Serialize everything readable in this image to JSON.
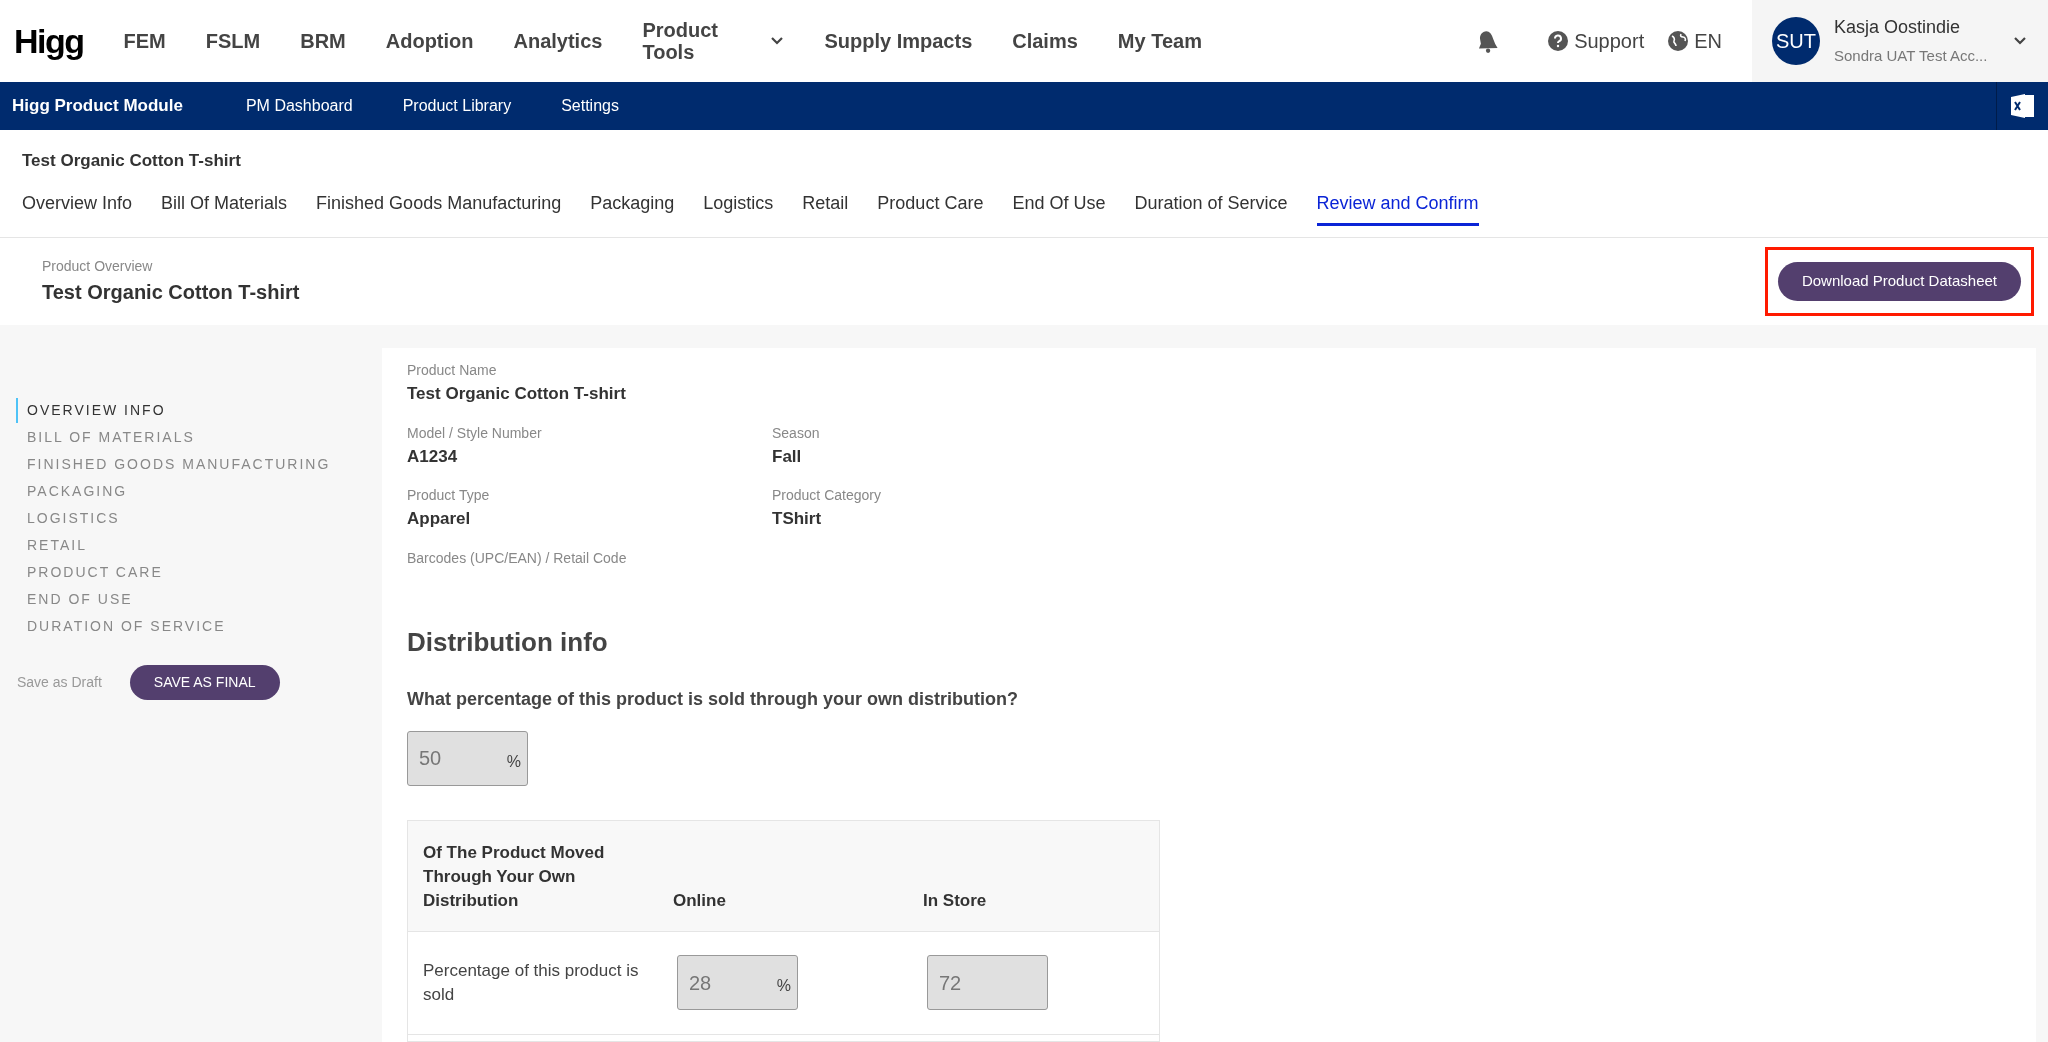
{
  "top_nav": {
    "logo": "Higg",
    "items": [
      {
        "label": "FEM",
        "dropdown": false
      },
      {
        "label": "FSLM",
        "dropdown": false
      },
      {
        "label": "BRM",
        "dropdown": false
      },
      {
        "label": "Adoption",
        "dropdown": false
      },
      {
        "label": "Analytics",
        "dropdown": false
      },
      {
        "label": "Product Tools",
        "dropdown": true
      },
      {
        "label": "Supply Impacts",
        "dropdown": false
      },
      {
        "label": "Claims",
        "dropdown": false
      },
      {
        "label": "My Team",
        "dropdown": false
      }
    ],
    "support": "Support",
    "language": "EN",
    "user": {
      "initials": "SUT",
      "name": "Kasja Oostindie",
      "organization": "Sondra UAT Test Acc..."
    }
  },
  "module_bar": {
    "title": "Higg Product Module",
    "items": [
      "PM Dashboard",
      "Product Library",
      "Settings"
    ]
  },
  "product_title": "Test Organic Cotton T-shirt",
  "tabs": [
    {
      "label": "Overview Info",
      "selected": false
    },
    {
      "label": "Bill Of Materials",
      "selected": false
    },
    {
      "label": "Finished Goods Manufacturing",
      "selected": false
    },
    {
      "label": "Packaging",
      "selected": false
    },
    {
      "label": "Logistics",
      "selected": false
    },
    {
      "label": "Retail",
      "selected": false
    },
    {
      "label": "Product Care",
      "selected": false
    },
    {
      "label": "End Of Use",
      "selected": false
    },
    {
      "label": "Duration of Service",
      "selected": false
    },
    {
      "label": "Review and Confirm",
      "selected": true
    }
  ],
  "overview": {
    "label": "Product Overview",
    "title": "Test Organic Cotton T-shirt",
    "download_button": "Download Product Datasheet",
    "highlighted": true
  },
  "sidebar": {
    "items": [
      {
        "label": "OVERVIEW INFO",
        "selected": true
      },
      {
        "label": "BILL OF MATERIALS",
        "selected": false
      },
      {
        "label": "FINISHED GOODS MANUFACTURING",
        "selected": false
      },
      {
        "label": "PACKAGING",
        "selected": false
      },
      {
        "label": "LOGISTICS",
        "selected": false
      },
      {
        "label": "RETAIL",
        "selected": false
      },
      {
        "label": "PRODUCT CARE",
        "selected": false
      },
      {
        "label": "END OF USE",
        "selected": false
      },
      {
        "label": "DURATION OF SERVICE",
        "selected": false
      }
    ],
    "draft_button": "Save as Draft",
    "final_button": "SAVE AS FINAL"
  },
  "fields": [
    [
      {
        "label": "Product Name",
        "value": "Test Organic Cotton T-shirt"
      }
    ],
    [
      {
        "label": "Model / Style Number",
        "value": "A1234"
      },
      {
        "label": "Season",
        "value": "Fall"
      }
    ],
    [
      {
        "label": "Product Type",
        "value": "Apparel"
      },
      {
        "label": "Product Category",
        "value": "TShirt"
      }
    ],
    [
      {
        "label": "Barcodes (UPC/EAN) / Retail Code"
      }
    ]
  ],
  "distribution": {
    "heading": "Distribution info",
    "question": "What percentage of this product is sold through your own distribution?",
    "own_share": {
      "value": "50",
      "unit": "%",
      "disabled": true
    },
    "table": {
      "columns": [
        "Of The Product Moved Through Your Own Distribution",
        "Online",
        "In Store"
      ],
      "rows": [
        {
          "label": "Percentage of this product is sold",
          "online": {
            "value": "28",
            "unit": "%",
            "disabled": true
          },
          "in_store": {
            "value": "72",
            "disabled": true
          }
        }
      ]
    }
  }
}
